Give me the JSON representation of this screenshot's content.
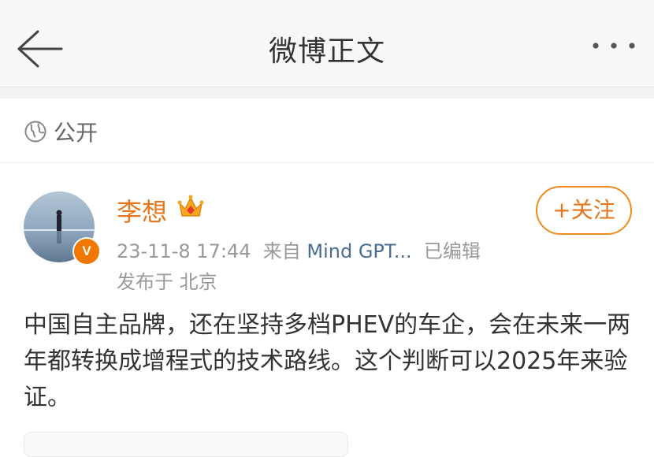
{
  "header": {
    "title": "微博正文",
    "back_icon": "back-arrow-icon",
    "more_icon": "more-dots-icon"
  },
  "visibility": {
    "icon": "globe-icon",
    "label": "公开"
  },
  "post": {
    "author": "李想",
    "verified_badge": "V",
    "member_icon": "crown-icon",
    "follow_label": "+关注",
    "timestamp": "23-11-8 17:44",
    "source_prefix": "来自",
    "source": "Mind GPT...",
    "edited": "已编辑",
    "location_prefix": "发布于",
    "location": "北京",
    "text": "中国自主品牌，还在坚持多档PHEV的车企，会在未来一两年都转换成增程式的技术路线。这个判断可以2025年来验证。"
  },
  "colors": {
    "accent": "#e5761b",
    "link": "#4a6d94",
    "muted": "#999999"
  }
}
